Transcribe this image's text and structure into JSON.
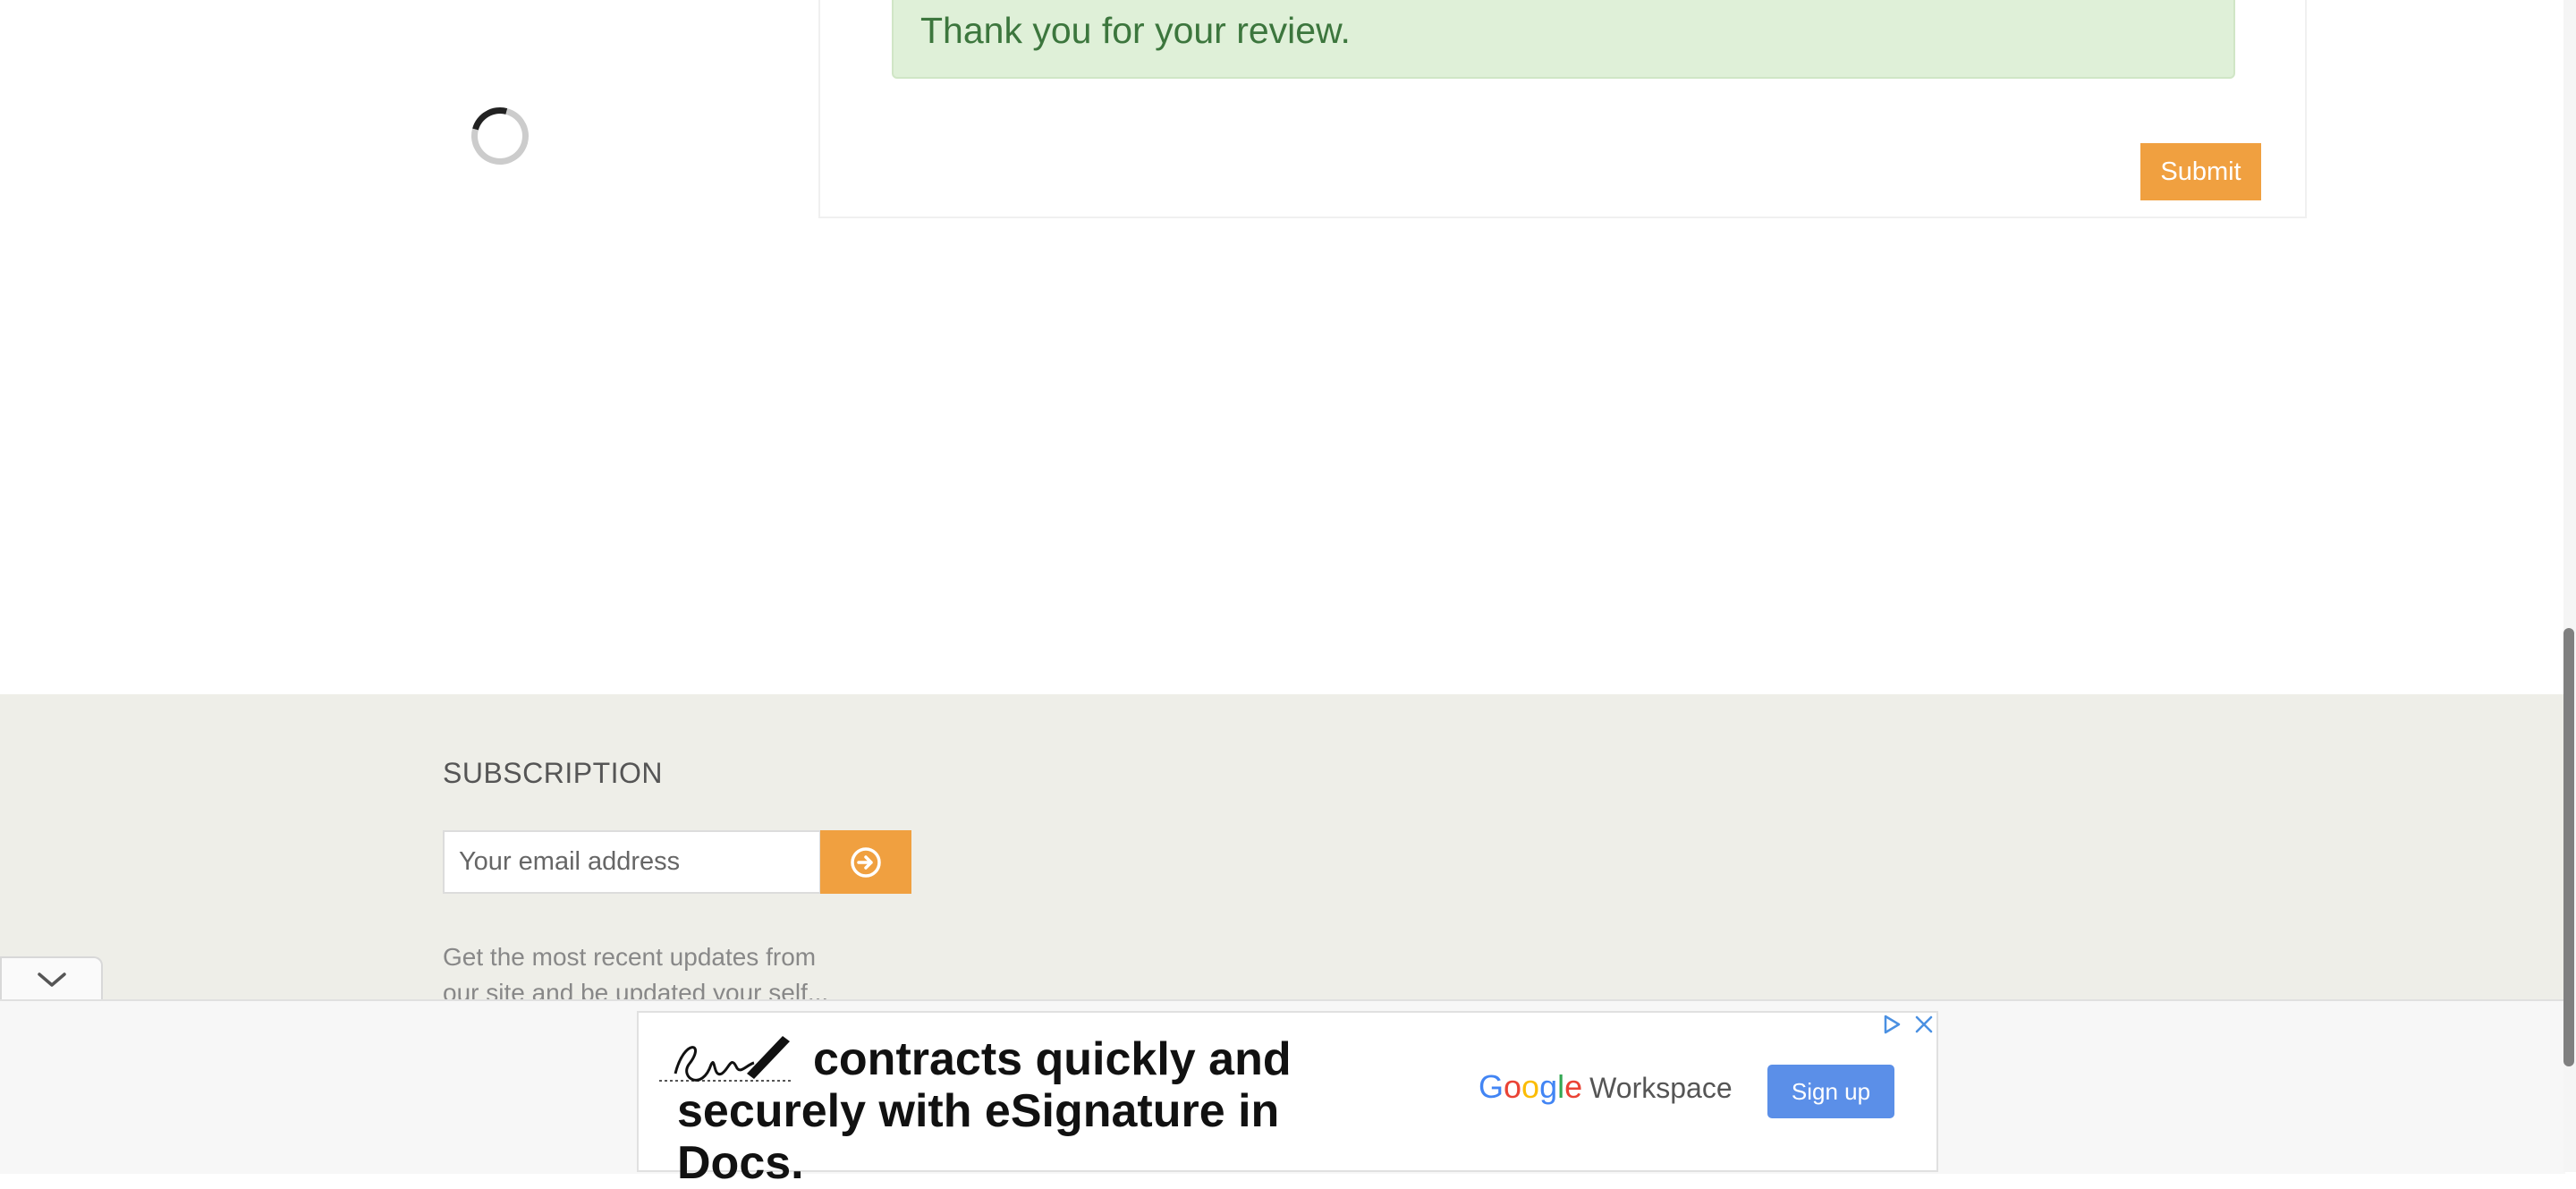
{
  "review": {
    "success_message": "Thank you for your review.",
    "submit_label": "Submit"
  },
  "footer": {
    "subscription_title": "SUBSCRIPTION",
    "email_placeholder": "Your email address",
    "description": "Get the most recent updates from our site and be updated your self..."
  },
  "ad": {
    "headline_line1": "contracts quickly and",
    "headline_line2": "securely with eSignature in Docs.",
    "sign_graphic_text": "Sign",
    "brand_google": "Google",
    "brand_product": "Workspace",
    "cta_label": "Sign up",
    "icons": [
      "adchoices-icon",
      "close-icon"
    ]
  },
  "colors": {
    "accent": "#f0a040",
    "success_bg": "#dff0d8",
    "success_text": "#3c763d",
    "footer_bg": "#eeeee8",
    "ad_cta": "#5b8fe8"
  }
}
